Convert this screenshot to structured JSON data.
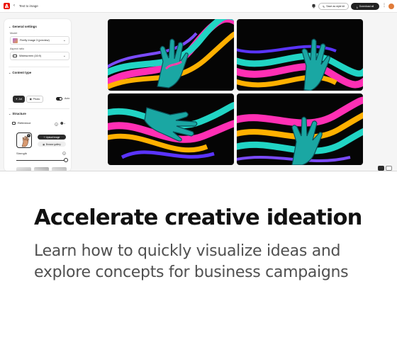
{
  "topbar": {
    "breadcrumb": "Text to image",
    "style_kit_label": "Save as style kit",
    "download_label": "Download all"
  },
  "general_settings": {
    "title": "General settings",
    "model_label": "Model",
    "model_value": "Firefly Image 3 (preview)",
    "aspect_label": "Aspect ratio",
    "aspect_value": "Widescreen (16:9)"
  },
  "content_type": {
    "title": "Content type",
    "options": [
      "Art",
      "Photo"
    ],
    "selected": "Art",
    "auto_label": "Auto",
    "auto_on": true
  },
  "structure": {
    "title": "Structure",
    "reference_label": "Reference",
    "upload_label": "Upload image",
    "browse_label": "Browse gallery",
    "strength_label": "Strength",
    "strength_level": 1.0
  },
  "gallery": {
    "image_count": 4,
    "subject": "glossy neon-coloured hand with flowing ribbons on black background"
  },
  "colors": {
    "accent": "#eb1000",
    "dark_button": "#2c2c2c",
    "headline": "#111111",
    "subtext": "#505050"
  },
  "promo": {
    "headline": "Accelerate creative ideation",
    "subline_1": "Learn how to quickly visualize ideas and",
    "subline_2": "explore concepts for business campaigns"
  }
}
